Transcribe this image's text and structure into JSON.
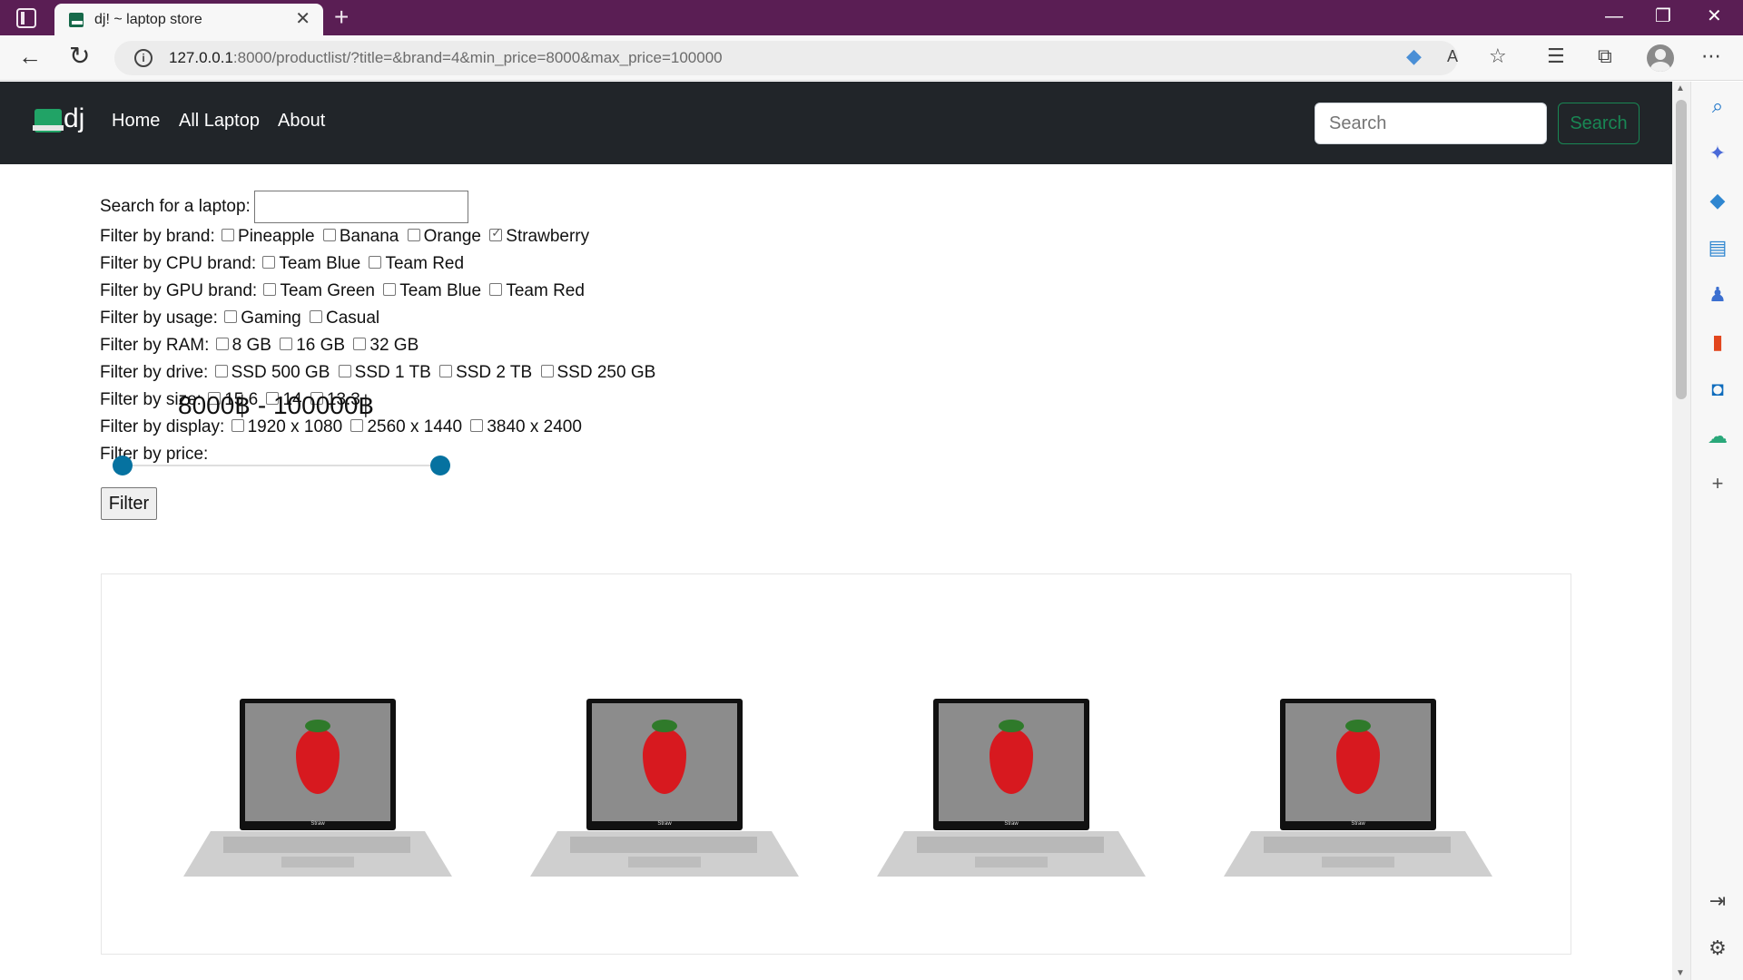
{
  "browser": {
    "tab_title": "dj! ~ laptop store",
    "url_host": "127.0.0.1",
    "url_rest": ":8000/productlist/?title=&brand=4&min_price=8000&max_price=100000",
    "new_tab_glyph": "+",
    "close_tab_glyph": "✕",
    "window_controls": [
      "—",
      "❐",
      "✕"
    ]
  },
  "navbar": {
    "brand": "dj",
    "links": [
      "Home",
      "All Laptop",
      "About"
    ],
    "search_placeholder": "Search",
    "search_button": "Search"
  },
  "filters": {
    "search_label": "Search for a laptop:",
    "brand": {
      "label": "Filter by brand:",
      "options": [
        "Pineapple",
        "Banana",
        "Orange",
        "Strawberry"
      ],
      "checked": [
        "Strawberry"
      ]
    },
    "cpu": {
      "label": "Filter by CPU brand:",
      "options": [
        "Team Blue",
        "Team Red"
      ]
    },
    "gpu": {
      "label": "Filter by GPU brand:",
      "options": [
        "Team Green",
        "Team Blue",
        "Team Red"
      ]
    },
    "usage": {
      "label": "Filter by usage:",
      "options": [
        "Gaming",
        "Casual"
      ]
    },
    "ram": {
      "label": "Filter by RAM:",
      "options": [
        "8 GB",
        "16 GB",
        "32 GB"
      ]
    },
    "drive": {
      "label": "Filter by drive:",
      "options": [
        "SSD 500 GB",
        "SSD 1 TB",
        "SSD 2 TB",
        "SSD 250 GB"
      ]
    },
    "size": {
      "label": "Filter by size:",
      "options": [
        "15.6",
        "14",
        "13.3"
      ]
    },
    "display": {
      "label": "Filter by display:",
      "options": [
        "1920 x 1080",
        "2560 x 1440",
        "3840 x 2400"
      ]
    },
    "price": {
      "label": "Filter by price:",
      "range_text": "8000฿ - 100000฿",
      "min": 8000,
      "max": 100000
    },
    "submit": "Filter"
  },
  "products": [
    {
      "brand_label": "Straw"
    },
    {
      "brand_label": "Straw"
    },
    {
      "brand_label": "Straw"
    },
    {
      "brand_label": "Straw"
    }
  ],
  "icons": {
    "sidebar": [
      "search-icon",
      "copilot-icon",
      "shopping-icon",
      "tools-icon",
      "games-icon",
      "office-icon",
      "outlook-icon",
      "drop-icon",
      "add-icon",
      "split-screen-icon",
      "settings-icon"
    ]
  },
  "colors": {
    "tabbar": "#5a1e54",
    "navbar": "#212529",
    "accent_green": "#198754",
    "slider": "#0672a0"
  }
}
